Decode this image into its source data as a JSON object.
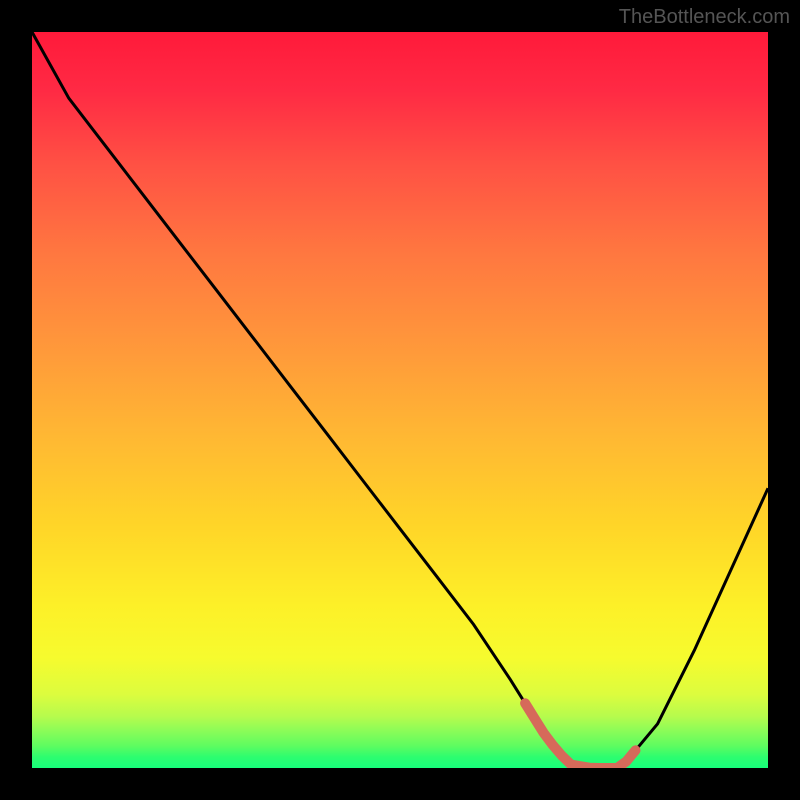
{
  "attribution": "TheBottleneck.com",
  "chart_data": {
    "type": "line",
    "title": "",
    "xlabel": "",
    "ylabel": "",
    "x": [
      0,
      0.05,
      0.1,
      0.15,
      0.2,
      0.25,
      0.3,
      0.35,
      0.4,
      0.45,
      0.5,
      0.55,
      0.6,
      0.65,
      0.7,
      0.73,
      0.76,
      0.8,
      0.85,
      0.9,
      0.95,
      1.0
    ],
    "values": [
      1.0,
      0.91,
      0.845,
      0.78,
      0.715,
      0.65,
      0.585,
      0.52,
      0.455,
      0.39,
      0.325,
      0.26,
      0.195,
      0.12,
      0.04,
      0.005,
      0.0,
      0.0,
      0.06,
      0.16,
      0.27,
      0.38
    ],
    "ylim": [
      0,
      1
    ],
    "xlim": [
      0,
      1
    ],
    "highlight_range_x": [
      0.67,
      0.82
    ],
    "gradient_colors": {
      "top": "#ff1a3a",
      "middle": "#ffd528",
      "bottom": "#17fe7a"
    }
  }
}
